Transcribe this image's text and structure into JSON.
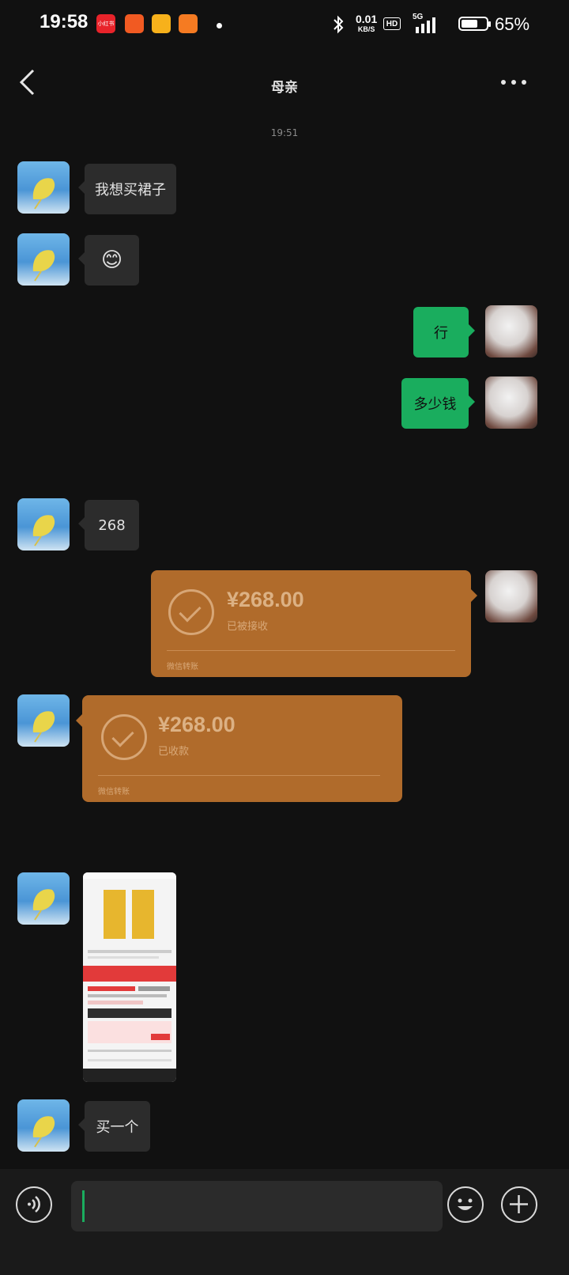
{
  "status_bar": {
    "time": "19:58",
    "apps": [
      "小红书",
      "",
      "",
      ""
    ],
    "net_speed_value": "0.01",
    "net_speed_unit": "KB/S",
    "hd": "HD",
    "signal": "5G",
    "battery": "65%",
    "battery_level": 0.65
  },
  "header": {
    "back_icon": "chevron-left-icon",
    "title": "母亲",
    "more_icon": "more-horizontal-icon"
  },
  "chat": {
    "timestamp": "19:51",
    "messages": [
      {
        "sender": "mom",
        "type": "text",
        "text": "我想买裙子"
      },
      {
        "sender": "mom",
        "type": "emoji",
        "text": "😊"
      },
      {
        "sender": "me",
        "type": "text",
        "text": "行"
      },
      {
        "sender": "me",
        "type": "text",
        "text": "多少钱"
      },
      {
        "sender": "mom",
        "type": "text",
        "text": "268"
      },
      {
        "sender": "me",
        "type": "transfer",
        "amount": "¥268.00",
        "status": "已被接收",
        "footer": "微信转账"
      },
      {
        "sender": "mom",
        "type": "transfer",
        "amount": "¥268.00",
        "status": "已收款",
        "footer": "微信转账"
      },
      {
        "sender": "mom",
        "type": "image",
        "description": "screenshot-thumbnail"
      },
      {
        "sender": "mom",
        "type": "text",
        "text": "买一个"
      }
    ]
  },
  "input_bar": {
    "voice_icon": "voice-icon",
    "emoji_icon": "emoji-icon",
    "plus_icon": "plus-icon",
    "input_value": ""
  },
  "colors": {
    "background": "#111111",
    "bubble_in": "#2c2c2c",
    "bubble_out": "#1aad5e",
    "transfer_card": "#b06b2b"
  }
}
